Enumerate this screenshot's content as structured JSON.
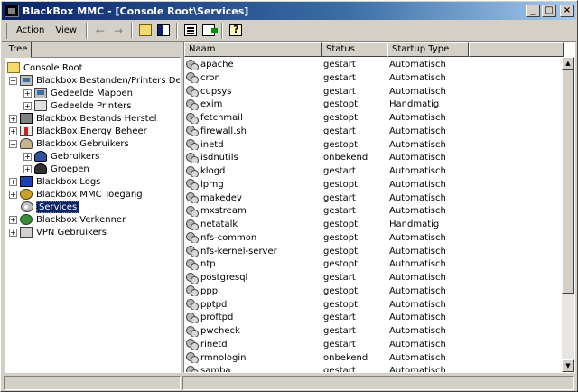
{
  "window": {
    "title": "BlackBox MMC - [Console Root\\Services]",
    "caption_buttons": [
      "_",
      "□",
      "×"
    ]
  },
  "menu": {
    "action": "Action",
    "view": "View"
  },
  "toolbar": {
    "back_glyph": "←",
    "forward_glyph": "→",
    "icons": [
      "back-icon",
      "forward-icon",
      "up-folder-icon",
      "show-hide-tree-icon",
      "properties-icon",
      "export-list-icon",
      "help-icon"
    ]
  },
  "tree": {
    "tab_label": "Tree",
    "items": [
      {
        "label": "Console Root",
        "icon": "folder",
        "expander": ""
      },
      {
        "label": "Blackbox Bestanden/Printers Delen",
        "icon": "computer",
        "expander": "−"
      },
      {
        "label": "Gedeelde Mappen",
        "icon": "computer",
        "expander": "+"
      },
      {
        "label": "Gedeelde Printers",
        "icon": "printer",
        "expander": "+"
      },
      {
        "label": "Blackbox Bestands Herstel",
        "icon": "disk",
        "expander": "+"
      },
      {
        "label": "BlackBox Energy Beheer",
        "icon": "energy",
        "expander": "+"
      },
      {
        "label": "Blackbox Gebruikers",
        "icon": "users",
        "expander": "−"
      },
      {
        "label": "Gebruikers",
        "icon": "user",
        "expander": "+"
      },
      {
        "label": "Groepen",
        "icon": "group",
        "expander": "+"
      },
      {
        "label": "Blackbox Logs",
        "icon": "log",
        "expander": "+"
      },
      {
        "label": "Blackbox MMC Toegang",
        "icon": "key",
        "expander": "+"
      },
      {
        "label": "Services",
        "icon": "gears",
        "expander": "",
        "selected": true
      },
      {
        "label": "Blackbox Verkenner",
        "icon": "globe",
        "expander": "+"
      },
      {
        "label": "VPN Gebruikers",
        "icon": "vpn",
        "expander": "+"
      }
    ]
  },
  "list": {
    "columns": [
      "Naam",
      "Status",
      "Startup Type"
    ],
    "rows": [
      {
        "name": "apache",
        "status": "gestart",
        "startup": "Automatisch"
      },
      {
        "name": "cron",
        "status": "gestart",
        "startup": "Automatisch"
      },
      {
        "name": "cupsys",
        "status": "gestart",
        "startup": "Automatisch"
      },
      {
        "name": "exim",
        "status": "gestopt",
        "startup": "Handmatig"
      },
      {
        "name": "fetchmail",
        "status": "gestopt",
        "startup": "Automatisch"
      },
      {
        "name": "firewall.sh",
        "status": "gestart",
        "startup": "Automatisch"
      },
      {
        "name": "inetd",
        "status": "gestopt",
        "startup": "Automatisch"
      },
      {
        "name": "isdnutils",
        "status": "onbekend",
        "startup": "Automatisch"
      },
      {
        "name": "klogd",
        "status": "gestart",
        "startup": "Automatisch"
      },
      {
        "name": "lprng",
        "status": "gestopt",
        "startup": "Automatisch"
      },
      {
        "name": "makedev",
        "status": "gestart",
        "startup": "Automatisch"
      },
      {
        "name": "mxstream",
        "status": "gestart",
        "startup": "Automatisch"
      },
      {
        "name": "netatalk",
        "status": "gestopt",
        "startup": "Handmatig"
      },
      {
        "name": "nfs-common",
        "status": "gestopt",
        "startup": "Automatisch"
      },
      {
        "name": "nfs-kernel-server",
        "status": "gestopt",
        "startup": "Automatisch"
      },
      {
        "name": "ntp",
        "status": "gestopt",
        "startup": "Automatisch"
      },
      {
        "name": "postgresql",
        "status": "gestart",
        "startup": "Automatisch"
      },
      {
        "name": "ppp",
        "status": "gestopt",
        "startup": "Automatisch"
      },
      {
        "name": "pptpd",
        "status": "gestopt",
        "startup": "Automatisch"
      },
      {
        "name": "proftpd",
        "status": "gestart",
        "startup": "Automatisch"
      },
      {
        "name": "pwcheck",
        "status": "gestart",
        "startup": "Automatisch"
      },
      {
        "name": "rinetd",
        "status": "gestart",
        "startup": "Automatisch"
      },
      {
        "name": "rmnologin",
        "status": "onbekend",
        "startup": "Automatisch"
      },
      {
        "name": "samba",
        "status": "gestart",
        "startup": "Automatisch"
      }
    ]
  },
  "scrollbar": {
    "up_glyph": "▲",
    "down_glyph": "▼"
  }
}
